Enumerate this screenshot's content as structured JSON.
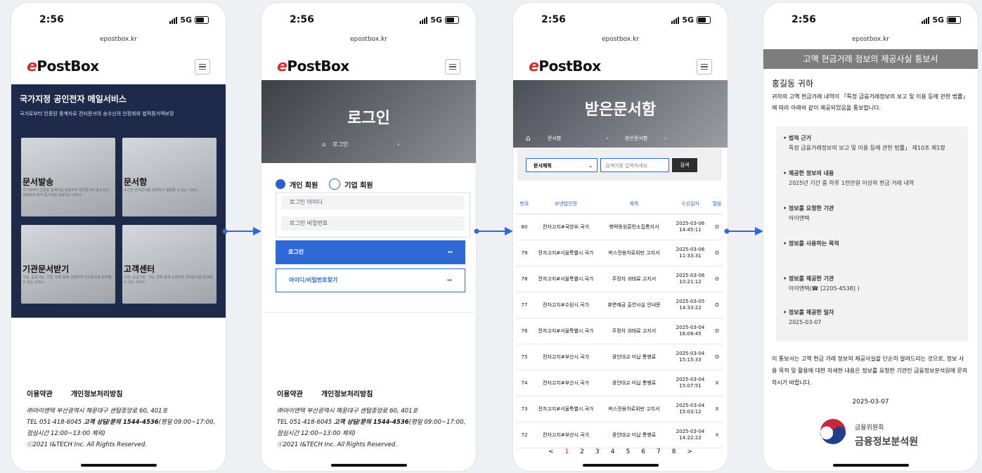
{
  "status": {
    "time": "2:56",
    "network": "5G"
  },
  "url": "epostbox.kr",
  "logo": {
    "e": "e",
    "rest": "PostBox"
  },
  "screen1": {
    "hero_title": "국가지정 공인전자 메일서비스",
    "hero_sub": "국가로부터 인증된 중계자로 전자문서의 송수신의 안정화와 법적증거력보장",
    "cards": [
      {
        "title": "문서발송",
        "desc": "국가로부터 인증된 중계자를 활용하여 전자문서의 송수신의 안정화와 법적 증거력을 보장하는 서비스"
      },
      {
        "title": "문서함",
        "desc": "수신한 전자문서를 보관하고 열람할 수 있는 서비스"
      },
      {
        "title": "기관문서받기",
        "desc": "기관, 공공기관, 기업, 단체 등에 신청하여 전자문서를 받아볼 수 있는 서비스"
      },
      {
        "title": "고객센터",
        "desc": "기관, 공공기관, 기업, 단체 등에 신청하여 전자문서를 받아볼 수 있는 서비스"
      }
    ]
  },
  "footer": {
    "terms": "이용약관",
    "privacy": "개인정보처리방침",
    "line1": "㈜아이앤텍 부산광역시 해운대구 센텀중앙로 60, 401호",
    "line2_pre": "TEL 051-418-6045 ",
    "line2_bold": "고객 상담/문의 1544-4536",
    "line2_post": "(평일 09:00~17:00,",
    "line3": "점심시간 12:00~13:00 제외)",
    "line4": "ⓒ2021 I&TECH Inc. All Rights Reserved."
  },
  "screen2": {
    "hero_title": "로그인",
    "breadcrumb": "로그인",
    "radio_personal": "개인 회원",
    "radio_corp": "기업 회원",
    "id_placeholder": "로그인 아이디",
    "pw_placeholder": "로그인 비밀번호",
    "login_btn": "로그인",
    "find_btn": "아이디/비밀번호찾기"
  },
  "screen3": {
    "hero_title": "받은문서함",
    "breadcrumb": [
      "문서함",
      "받은문서함"
    ],
    "select_value": "문서제목",
    "search_placeholder": "검색어를 입력하세요",
    "search_btn": "검색",
    "columns": [
      "번호",
      "보낸법인명",
      "제목",
      "수신일자",
      "열람"
    ],
    "rows": [
      {
        "no": "80",
        "sender": "전자고지#국방부.국가",
        "title": "병력동원훈련소집통지서",
        "date": "2025-03-06",
        "time": "14:45:11",
        "read": "O"
      },
      {
        "no": "79",
        "sender": "전자고지#서울특별시.국가",
        "title": "버스전용차로위반 고지서",
        "date": "2025-03-06",
        "time": "11:33:31",
        "read": "O"
      },
      {
        "no": "78",
        "sender": "전자고지#서울특별시.국가",
        "title": "주정차 과태료 고지서",
        "date": "2025-03-06",
        "time": "10:21:12",
        "read": "O"
      },
      {
        "no": "77",
        "sender": "전자고지#수원시.국가",
        "title": "휴면예금 출연사실 안내문",
        "date": "2025-03-05",
        "time": "14:33:22",
        "read": "O"
      },
      {
        "no": "76",
        "sender": "전자고지#서울특별시.국가",
        "title": "주정차 과태료 고지서",
        "date": "2025-03-04",
        "time": "16:09:45",
        "read": "O"
      },
      {
        "no": "75",
        "sender": "전자고지#부산시.국가",
        "title": "광안대교 미납 통행료",
        "date": "2025-03-04",
        "time": "15:15:33",
        "read": "O"
      },
      {
        "no": "74",
        "sender": "전자고지#부산시.국가",
        "title": "광안대교 미납 통행료",
        "date": "2025-03-04",
        "time": "15:07:51",
        "read": "X"
      },
      {
        "no": "73",
        "sender": "전자고지#서울특별시.국가",
        "title": "버스전용차로위반 고지서",
        "date": "2025-03-04",
        "time": "15:03:12",
        "read": "X"
      },
      {
        "no": "72",
        "sender": "전자고지#부산시.국가",
        "title": "광안대교 미납 통행료",
        "date": "2025-03-04",
        "time": "14:22:22",
        "read": "X"
      }
    ],
    "pages": [
      "1",
      "2",
      "3",
      "4",
      "5",
      "6",
      "7",
      "8"
    ],
    "prev": "<",
    "next": ">"
  },
  "screen4": {
    "banner": "고액 현금거래 정보의 제공사실 통보서",
    "to": "홍길동 귀하",
    "intro": "귀하의 고액 현금거래 내역이 「특정 금융거래정보의 보고 및 이용 등에 관한 법률」에 따라 아래와 같이 제공되었음을 통보합니다.",
    "items": [
      {
        "h": "법적 근거",
        "v": "특정 금융거래정보의 보고 및 이용 등에 관한 법률」 제10조 제1항"
      },
      {
        "h": "제공한 정보의 내용",
        "v": "2025년 기간 중 하루 1천만원 이상의 현금 거래 내역"
      },
      {
        "h": "정보를 요청한 기관",
        "v": "아이앤텍"
      },
      {
        "h": "정보를 사용하는 목적",
        "v": ""
      },
      {
        "h": "정보를 제공한 기관",
        "v": "아이앤텍(☎ [2205-4538] )"
      },
      {
        "h": "정보를 제공한 일자",
        "v": "2025-03-07"
      }
    ],
    "note": "이 통보서는 고액 현금 거래 정보의 제공사실을 단순히 알려드리는 것으로, 정보 사용 목적 및 활용에 대한 자세한 내용은 정보를 요청한 기관인 금융정보분석원에 문의 하시기 바랍니다.",
    "date": "2025-03-07",
    "org_small": "금융위원회",
    "org_big": "금융정보분석원"
  },
  "colors": {
    "accent": "#2f69d6",
    "brand_red": "#d32f2f",
    "navy": "#1e2a4a"
  }
}
